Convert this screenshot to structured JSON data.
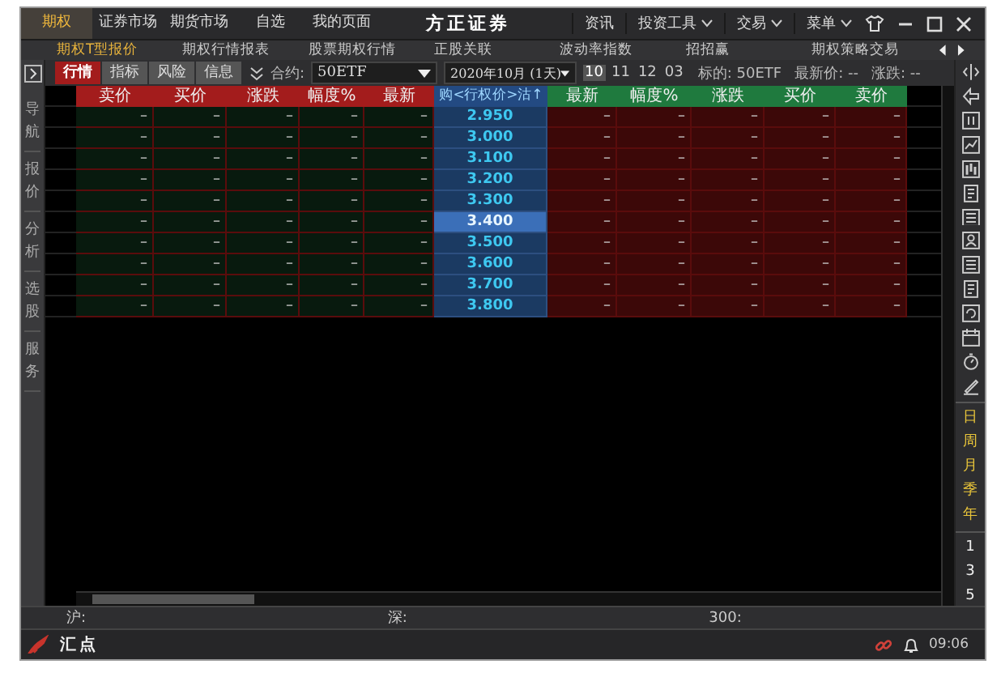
{
  "title_bar": {
    "tabs": [
      {
        "label": "期权",
        "selected": true
      },
      {
        "label": "证券市场",
        "selected": false
      },
      {
        "label": "期货市场",
        "selected": false
      },
      {
        "label": "自选",
        "selected": false
      },
      {
        "label": "我的页面",
        "selected": false
      }
    ],
    "brand": "方正证券",
    "menus": [
      {
        "label": "资讯",
        "dropdown": false
      },
      {
        "label": "投资工具",
        "dropdown": true
      },
      {
        "label": "交易",
        "dropdown": true
      },
      {
        "label": "菜单",
        "dropdown": true
      }
    ]
  },
  "sub_tabs": [
    {
      "label": "期权T型报价",
      "selected": true
    },
    {
      "label": "期权行情报表",
      "selected": false
    },
    {
      "label": "股票期权行情",
      "selected": false
    },
    {
      "label": "正股关联",
      "selected": false
    },
    {
      "label": "波动率指数",
      "selected": false
    },
    {
      "label": "招招赢",
      "selected": false
    },
    {
      "label": "期权策略交易",
      "selected": false
    }
  ],
  "toolbar": {
    "view_tabs": [
      {
        "label": "行情",
        "selected": true
      },
      {
        "label": "指标",
        "selected": false
      },
      {
        "label": "风险",
        "selected": false
      },
      {
        "label": "信息",
        "selected": false
      }
    ],
    "contract_label": "合约:",
    "contract_value": "50ETF",
    "month_value": "2020年10月 (1天)",
    "months": [
      {
        "label": "10",
        "selected": true
      },
      {
        "label": "11",
        "selected": false
      },
      {
        "label": "12",
        "selected": false
      },
      {
        "label": "03",
        "selected": false
      }
    ],
    "underlying": "标的: 50ETF",
    "latest": "最新价: --",
    "change": "涨跌: --"
  },
  "side_nav": [
    "导航",
    "报价",
    "分析",
    "选股",
    "服务"
  ],
  "table": {
    "call_columns": [
      "卖价",
      "买价",
      "涨跌",
      "幅度%",
      "最新"
    ],
    "strike_column": "购<行权价>沽↑",
    "put_columns": [
      "最新",
      "幅度%",
      "涨跌",
      "买价",
      "卖价"
    ],
    "rows": [
      {
        "strike": "2.950",
        "selected": false,
        "call": [
          "–",
          "–",
          "–",
          "–",
          "–"
        ],
        "put": [
          "–",
          "–",
          "–",
          "–",
          "–"
        ]
      },
      {
        "strike": "3.000",
        "selected": false,
        "call": [
          "–",
          "–",
          "–",
          "–",
          "–"
        ],
        "put": [
          "–",
          "–",
          "–",
          "–",
          "–"
        ]
      },
      {
        "strike": "3.100",
        "selected": false,
        "call": [
          "–",
          "–",
          "–",
          "–",
          "–"
        ],
        "put": [
          "–",
          "–",
          "–",
          "–",
          "–"
        ]
      },
      {
        "strike": "3.200",
        "selected": false,
        "call": [
          "–",
          "–",
          "–",
          "–",
          "–"
        ],
        "put": [
          "–",
          "–",
          "–",
          "–",
          "–"
        ]
      },
      {
        "strike": "3.300",
        "selected": false,
        "call": [
          "–",
          "–",
          "–",
          "–",
          "–"
        ],
        "put": [
          "–",
          "–",
          "–",
          "–",
          "–"
        ]
      },
      {
        "strike": "3.400",
        "selected": true,
        "call": [
          "–",
          "–",
          "–",
          "–",
          "–"
        ],
        "put": [
          "–",
          "–",
          "–",
          "–",
          "–"
        ]
      },
      {
        "strike": "3.500",
        "selected": false,
        "call": [
          "–",
          "–",
          "–",
          "–",
          "–"
        ],
        "put": [
          "–",
          "–",
          "–",
          "–",
          "–"
        ]
      },
      {
        "strike": "3.600",
        "selected": false,
        "call": [
          "–",
          "–",
          "–",
          "–",
          "–"
        ],
        "put": [
          "–",
          "–",
          "–",
          "–",
          "–"
        ]
      },
      {
        "strike": "3.700",
        "selected": false,
        "call": [
          "–",
          "–",
          "–",
          "–",
          "–"
        ],
        "put": [
          "–",
          "–",
          "–",
          "–",
          "–"
        ]
      },
      {
        "strike": "3.800",
        "selected": false,
        "call": [
          "–",
          "–",
          "–",
          "–",
          "–"
        ],
        "put": [
          "–",
          "–",
          "–",
          "–",
          "–"
        ]
      }
    ]
  },
  "periods": [
    {
      "label": "日"
    },
    {
      "label": "周"
    },
    {
      "label": "月"
    },
    {
      "label": "季"
    },
    {
      "label": "年"
    }
  ],
  "counts": [
    "1",
    "3",
    "5"
  ],
  "status": [
    "沪:",
    "深:",
    "300:"
  ],
  "bottom_bar": {
    "logo": "汇点",
    "time": "09:06"
  }
}
